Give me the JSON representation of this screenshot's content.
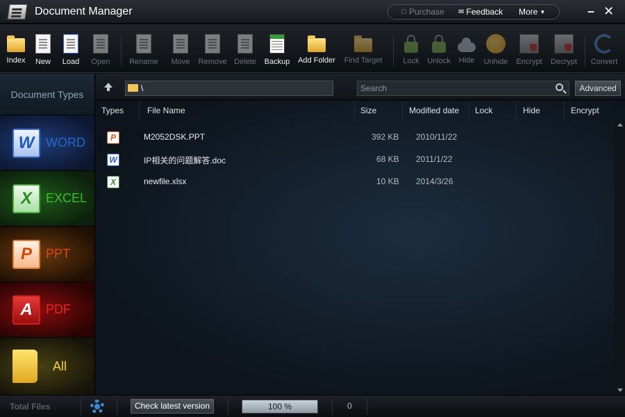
{
  "window": {
    "title": "Document Manager"
  },
  "top_links": {
    "purchase": "Purchase",
    "feedback": "Feedback",
    "more": "More"
  },
  "toolbar": [
    {
      "id": "index",
      "label": "Index",
      "enabled": true,
      "icon": "folder-refresh-icon"
    },
    {
      "id": "new",
      "label": "New",
      "enabled": true,
      "icon": "new-document-icon"
    },
    {
      "id": "load",
      "label": "Load",
      "enabled": true,
      "icon": "load-document-icon"
    },
    {
      "id": "open",
      "label": "Open",
      "enabled": false,
      "icon": "open-document-icon"
    },
    {
      "id": "rename",
      "label": "Rename",
      "enabled": false,
      "icon": "rename-icon"
    },
    {
      "id": "move",
      "label": "Move",
      "enabled": false,
      "icon": "move-icon"
    },
    {
      "id": "remove",
      "label": "Remove",
      "enabled": false,
      "icon": "remove-icon"
    },
    {
      "id": "delete",
      "label": "Delete",
      "enabled": false,
      "icon": "delete-icon"
    },
    {
      "id": "backup",
      "label": "Backup",
      "enabled": true,
      "icon": "backup-icon"
    },
    {
      "id": "add_folder",
      "label": "Add Folder",
      "enabled": true,
      "icon": "add-folder-icon"
    },
    {
      "id": "find_target",
      "label": "Find Target",
      "enabled": false,
      "icon": "find-target-icon"
    },
    {
      "id": "lock",
      "label": "Lock",
      "enabled": false,
      "icon": "lock-icon"
    },
    {
      "id": "unlock",
      "label": "Unlock",
      "enabled": false,
      "icon": "unlock-icon"
    },
    {
      "id": "hide",
      "label": "Hide",
      "enabled": false,
      "icon": "hide-cloud-icon"
    },
    {
      "id": "unhide",
      "label": "Unhide",
      "enabled": false,
      "icon": "unhide-sun-icon"
    },
    {
      "id": "encrypt",
      "label": "Encrypt",
      "enabled": false,
      "icon": "encrypt-icon"
    },
    {
      "id": "decrypt",
      "label": "Decrypt",
      "enabled": false,
      "icon": "decrypt-icon"
    },
    {
      "id": "convert",
      "label": "Convert",
      "enabled": false,
      "icon": "convert-icon"
    }
  ],
  "sidebar": {
    "heading": "Document Types",
    "categories": [
      {
        "name": "WORD",
        "badge": "W"
      },
      {
        "name": "EXCEL",
        "badge": "X"
      },
      {
        "name": "PPT",
        "badge": "P"
      },
      {
        "name": "PDF",
        "badge": "A"
      },
      {
        "name": "All",
        "badge": ""
      }
    ]
  },
  "pathbar": {
    "path": "\\",
    "search_placeholder": "Search",
    "advanced": "Advanced"
  },
  "columns": [
    "Types",
    "File Name",
    "Size",
    "Modified date",
    "Lock",
    "Hide",
    "Encrypt"
  ],
  "files": [
    {
      "type": "ppt",
      "type_glyph": "P",
      "name": "M2052DSK.PPT",
      "size": "392 KB",
      "modified": "2010/11/22"
    },
    {
      "type": "doc",
      "type_glyph": "W",
      "name": "IP相关的问题解答.doc",
      "size": "68 KB",
      "modified": "2011/1/22"
    },
    {
      "type": "xls",
      "type_glyph": "X",
      "name": "newfile.xlsx",
      "size": "10 KB",
      "modified": "2014/3/26"
    }
  ],
  "status": {
    "total_files": "Total Files",
    "check_version": "Check latest version",
    "progress_text": "100 %",
    "progress_value": 100,
    "count": "0"
  }
}
